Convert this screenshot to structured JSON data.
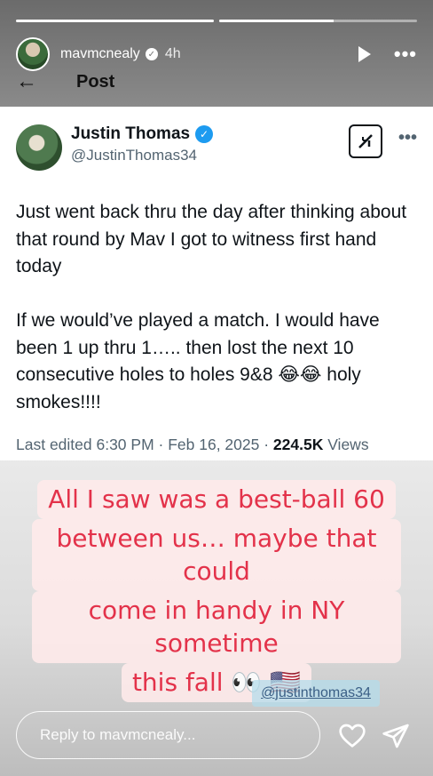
{
  "story": {
    "progress": [
      1.0,
      0.58
    ],
    "username": "mavmcnealy",
    "time": "4h",
    "icons": {
      "play": "play-icon",
      "more": "more-icon",
      "verified": "verified-icon"
    }
  },
  "post_nav": {
    "title": "Post",
    "back_icon": "back-arrow-icon"
  },
  "tweet": {
    "display_name": "Justin Thomas",
    "handle": "@JustinThomas34",
    "body": "Just went back thru the day after thinking about that round by Mav I got to witness first hand today\n\nIf we would’ve played a match. I would have been 1 up thru 1….. then lost the next 10 consecutive holes to holes 9&8 😂😂 holy smokes!!!!",
    "meta_prefix": "Last edited 6:30 PM · Feb 16, 2025 · ",
    "views_count": "224.5K",
    "views_label": " Views",
    "grok_icon": "grok-icon"
  },
  "caption": {
    "lines": [
      "All I saw was a best-ball 60",
      "between us… maybe that could",
      "come in handy in NY sometime",
      "this fall 👀 🇺🇸"
    ],
    "color": "#e3324a"
  },
  "mention": "@justinthomas34",
  "reply": {
    "placeholder": "Reply to mavmcnealy..."
  }
}
